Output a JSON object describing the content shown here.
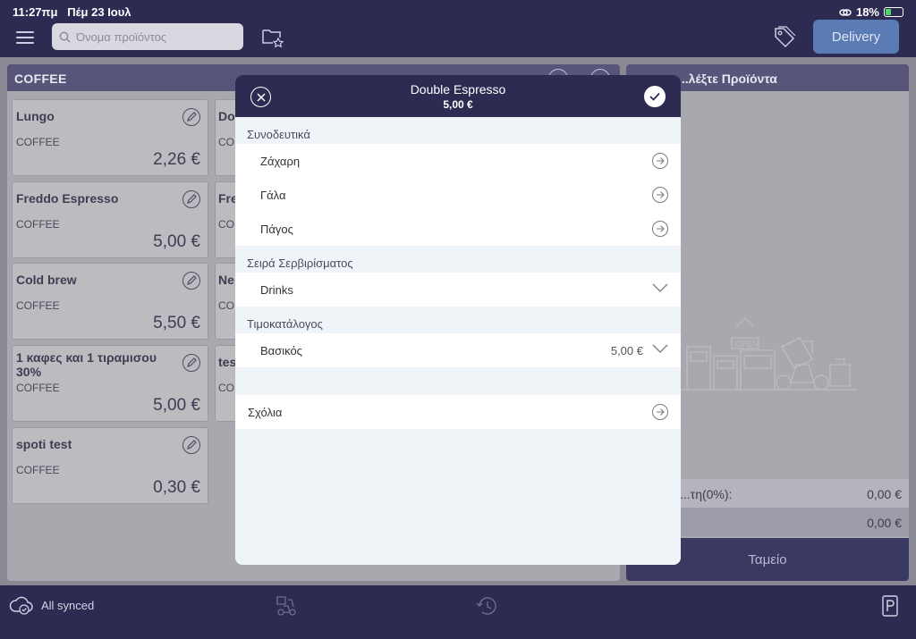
{
  "status_bar": {
    "time": "11:27πμ",
    "date": "Πέμ 23 Ιουλ",
    "battery": "18%"
  },
  "topbar": {
    "search_placeholder": "Όνομα προϊόντος",
    "delivery_label": "Delivery"
  },
  "category": {
    "title": "COFFEE"
  },
  "products": [
    {
      "name": "Lungo",
      "category": "COFFEE",
      "price": "2,26 €"
    },
    {
      "name": "Freddo Espresso",
      "category": "COFFEE",
      "price": "5,00 €"
    },
    {
      "name": "Cold brew",
      "category": "COFFEE",
      "price": "5,50 €"
    },
    {
      "name": "1 καφες και 1 τιραμισου 30%",
      "category": "COFFEE",
      "price": "5,00 €"
    },
    {
      "name": "spoti test",
      "category": "COFFEE",
      "price": "0,30 €"
    }
  ],
  "products_col2": [
    {
      "name": "Do",
      "category": "CO"
    },
    {
      "name": "Fre",
      "category": "CO"
    },
    {
      "name": "Ne",
      "category": "CO"
    },
    {
      "name": "tes",
      "category": "CO"
    }
  ],
  "order_panel": {
    "title": "...λέξτε Προϊόντα",
    "vat_label": "...τη(0%):",
    "vat_value": "0,00 €",
    "total_value": "0,00 €",
    "checkout_label": "Ταμείο"
  },
  "bottombar": {
    "sync_label": "All synced"
  },
  "modal": {
    "title": "Double Espresso",
    "price": "5,00 €",
    "sections": {
      "extras_title": "Συνοδευτικά",
      "extras": [
        "Ζάχαρη",
        "Γάλα",
        "Πάγος"
      ],
      "serving_title": "Σειρά Σερβιρίσματος",
      "serving_value": "Drinks",
      "pricelist_title": "Τιμοκατάλογος",
      "pricelist_value": "Βασικός",
      "pricelist_price": "5,00 €",
      "comments_label": "Σχόλια"
    }
  }
}
